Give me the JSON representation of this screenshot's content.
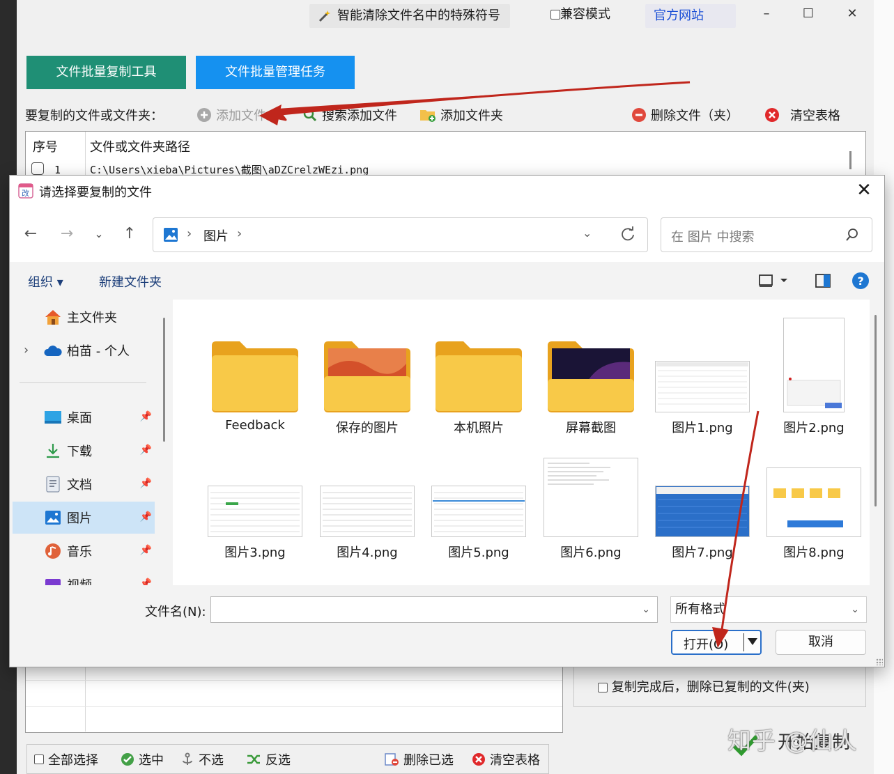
{
  "app": {
    "title_item": "智能清除文件名中的特殊符号",
    "compat_mode": "兼容模式",
    "website": "官方网站",
    "window_controls": {
      "minimize": "–",
      "maximize": "☐",
      "close": "✕"
    },
    "tabs": {
      "copy_tool": "文件批量复制工具",
      "manage_task": "文件批量管理任务"
    },
    "toolbar": {
      "label": "要复制的文件或文件夹：",
      "add_file": "添加文件",
      "search_add": "搜索添加文件",
      "add_folder": "添加文件夹",
      "delete_files": "删除文件（夹）",
      "clear_table": "清空表格"
    },
    "table": {
      "col_index": "序号",
      "col_path": "文件或文件夹路径",
      "rows": [
        {
          "index": "1",
          "path": "C:\\Users\\xieba\\Pictures\\截图\\aDZCrelzWEzi.png"
        }
      ]
    },
    "options": {
      "delete_after_copy": "复制完成后，删除已复制的文件(夹)"
    },
    "bottom_bar": {
      "select_all": "全部选择",
      "select": "选中",
      "deselect": "不选",
      "invert": "反选",
      "delete_selected": "删除已选",
      "clear_table": "清空表格"
    },
    "start_button": "开始复制",
    "watermark": "知乎 @仙人"
  },
  "dialog": {
    "title": "请选择要复制的文件",
    "close": "✕",
    "address": {
      "location": "图片"
    },
    "search_placeholder": "在 图片 中搜索",
    "commands": {
      "organize": "组织 ▾",
      "new_folder": "新建文件夹"
    },
    "nav": {
      "home": "主文件夹",
      "onedrive": "柏苗 - 个人",
      "desktop": "桌面",
      "downloads": "下载",
      "documents": "文档",
      "pictures": "图片",
      "music": "音乐",
      "videos": "视频"
    },
    "items": [
      {
        "name": "Feedback",
        "kind": "folder"
      },
      {
        "name": "保存的图片",
        "kind": "folder"
      },
      {
        "name": "本机照片",
        "kind": "folder"
      },
      {
        "name": "屏幕截图",
        "kind": "folder"
      },
      {
        "name": "图片1.png",
        "kind": "image"
      },
      {
        "name": "图片2.png",
        "kind": "image"
      },
      {
        "name": "图片3.png",
        "kind": "image"
      },
      {
        "name": "图片4.png",
        "kind": "image"
      },
      {
        "name": "图片5.png",
        "kind": "image"
      },
      {
        "name": "图片6.png",
        "kind": "image"
      },
      {
        "name": "图片7.png",
        "kind": "image"
      },
      {
        "name": "图片8.png",
        "kind": "image"
      }
    ],
    "filename_label": "文件名(N):",
    "filename_value": "",
    "format_selected": "所有格式",
    "open_button": "打开(O)",
    "cancel_button": "取消"
  },
  "colors": {
    "tab_copy": "#1f8f75",
    "tab_manage": "#1591f0",
    "annotation_arrow": "#c0261c",
    "selection": "#cde4f7",
    "folder": "#f6c445"
  }
}
